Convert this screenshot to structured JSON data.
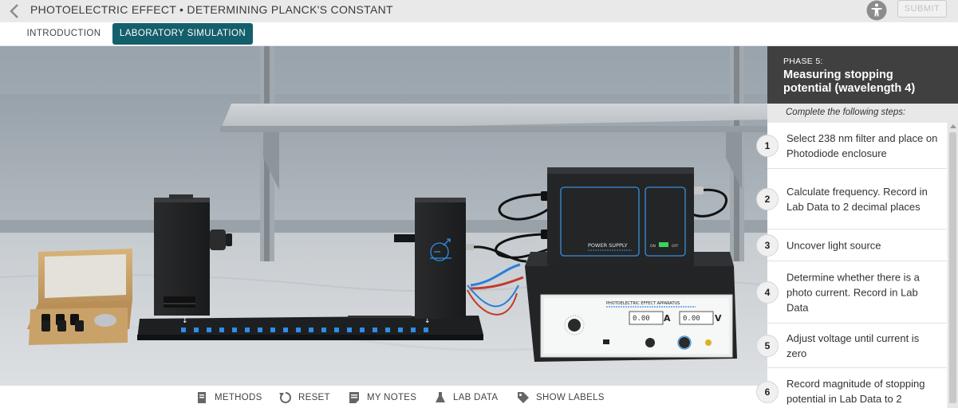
{
  "header": {
    "title": "PHOTOELECTRIC EFFECT • DETERMINING PLANCK'S CONSTANT",
    "submit_label": "SUBMIT"
  },
  "tabs": [
    {
      "label": "INTRODUCTION",
      "active": false
    },
    {
      "label": "LABORATORY SIMULATION",
      "active": true
    }
  ],
  "scene": {
    "power_supply_label": "POWER SUPPLY",
    "switch_on": "ON",
    "switch_off": "OFF",
    "apparatus_label": "PHOTOELECTRIC EFFECT APPARATUS",
    "current_display": "0.00",
    "current_unit": "A",
    "voltage_display": "0.00",
    "voltage_unit": "V"
  },
  "toolbar": [
    {
      "label": "METHODS",
      "icon": "book-icon"
    },
    {
      "label": "RESET",
      "icon": "reset-icon"
    },
    {
      "label": "MY NOTES",
      "icon": "notes-icon"
    },
    {
      "label": "LAB DATA",
      "icon": "flask-icon"
    },
    {
      "label": "SHOW LABELS",
      "icon": "tag-icon"
    }
  ],
  "panel": {
    "phase_label": "PHASE 5:",
    "phase_title": "Measuring stopping potential (wavelength 4)",
    "instruction": "Complete the following steps:",
    "steps": [
      {
        "num": "1",
        "text": "Select 238 nm filter and place on Photodiode enclosure"
      },
      {
        "num": "2",
        "text": "Calculate frequency. Record in Lab Data to 2 decimal places"
      },
      {
        "num": "3",
        "text": "Uncover light source"
      },
      {
        "num": "4",
        "text": "Determine whether there is a photo current. Record in Lab Data"
      },
      {
        "num": "5",
        "text": "Adjust voltage until current is zero"
      },
      {
        "num": "6",
        "text": "Record magnitude of stopping potential in Lab Data to 2"
      }
    ]
  },
  "colors": {
    "accent": "#145f6c",
    "panel_header": "#404040",
    "led_blue": "#2f8de4",
    "switch_green": "#37d45a"
  }
}
